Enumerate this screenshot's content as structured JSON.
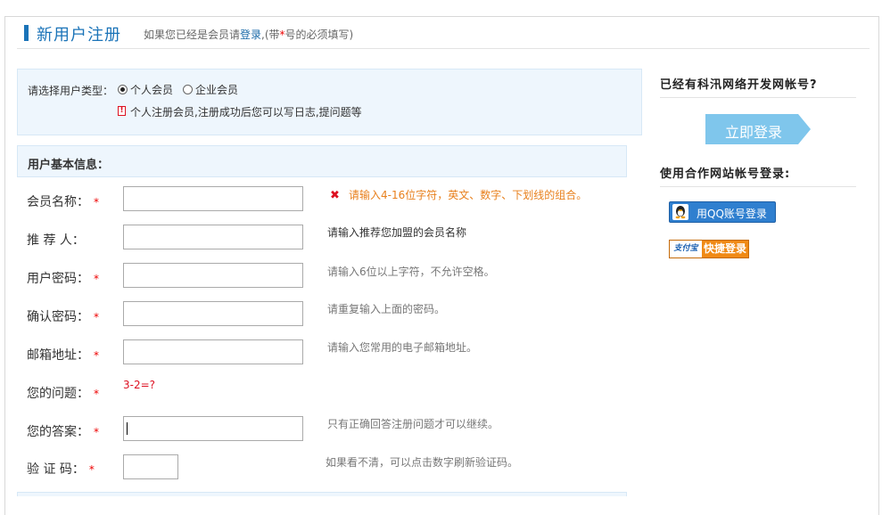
{
  "header": {
    "title": "新用户注册",
    "note_prefix": "如果您已经是会员请",
    "note_link": "登录",
    "note_mid": ",(带",
    "note_star": "*",
    "note_suffix": "号的必须填写)"
  },
  "user_type": {
    "label": "请选择用户类型：",
    "options": [
      {
        "label": "个人会员",
        "selected": true
      },
      {
        "label": "企业会员",
        "selected": false
      }
    ],
    "note": "个人注册会员,注册成功后您可以写日志,提问题等"
  },
  "basic_info": {
    "title": "用户基本信息：",
    "fields": [
      {
        "label": "会员名称：",
        "required": true,
        "value": "",
        "hint": "请输入4-16位字符，英文、数字、下划线的组合。",
        "hint_state": "error"
      },
      {
        "label": "推 荐 人：",
        "required": false,
        "value": "",
        "hint": "请输入推荐您加盟的会员名称",
        "hint_state": "info"
      },
      {
        "label": "用户密码：",
        "required": true,
        "value": "",
        "hint": "请输入6位以上字符，不允许空格。",
        "hint_state": "normal"
      },
      {
        "label": "确认密码：",
        "required": true,
        "value": "",
        "hint": "请重复输入上面的密码。",
        "hint_state": "normal"
      },
      {
        "label": "邮箱地址：",
        "required": true,
        "value": "",
        "hint": "请输入您常用的电子邮箱地址。",
        "hint_state": "normal"
      },
      {
        "label": "您的问题：",
        "required": true,
        "question": "3-2=?"
      },
      {
        "label": "您的答案：",
        "required": true,
        "value": "",
        "hint": "只有正确回答注册问题才可以继续。",
        "hint_state": "normal"
      },
      {
        "label": "验 证 码：",
        "required": true,
        "value": "",
        "hint": "如果看不清，可以点击数字刷新验证码。",
        "hint_state": "normal"
      }
    ],
    "required_mark": "*"
  },
  "sidebar": {
    "existing_title": "已经有科汛网络开发网帐号?",
    "login_button": "立即登录",
    "partner_title": "使用合作网站帐号登录:",
    "qq_button": "用QQ账号登录",
    "alipay_logo": "支付宝",
    "alipay_button": "快捷登录"
  },
  "colors": {
    "accent": "#1a73b8",
    "panel_bg": "#eef6fd",
    "required": "#e00000",
    "error_hint": "#e8801d",
    "login_button": "#7fc6ec"
  }
}
